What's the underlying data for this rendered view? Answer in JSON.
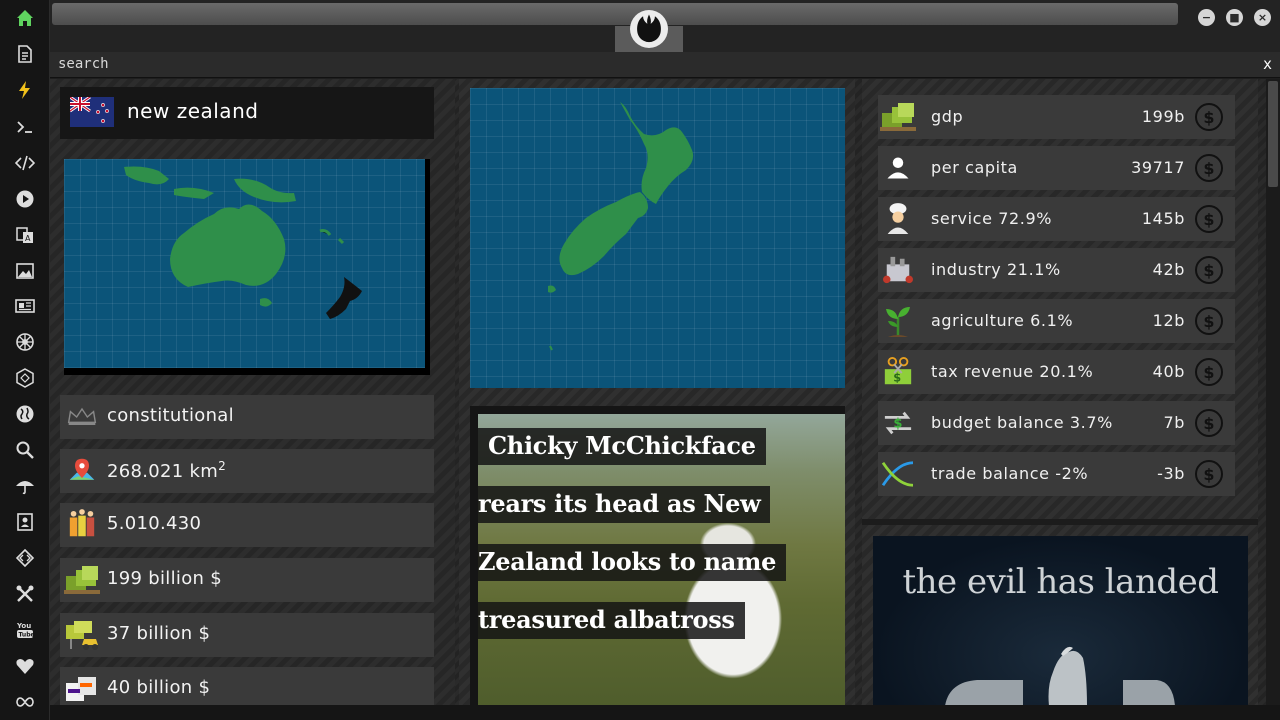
{
  "search": {
    "label": "search",
    "close": "x"
  },
  "window": {
    "minimize": "−",
    "maximize": "■",
    "close": "×"
  },
  "sidebar": {
    "icons": [
      "home-icon",
      "document-icon",
      "lightning-icon",
      "terminal-icon",
      "code-icon",
      "play-icon",
      "translate-icon",
      "image-icon",
      "news-icon",
      "empire-icon",
      "hexagon-icon",
      "globe-icon",
      "search-icon",
      "umbrella-icon",
      "contact-icon",
      "diamond-code-icon",
      "tools-icon",
      "youtube-icon",
      "heart-icon",
      "infinity-icon"
    ],
    "accent": "#5fd35f"
  },
  "country": {
    "name": "new zealand",
    "government": "constitutional",
    "area": "268.021 km",
    "area_exp": "2",
    "population": "5.010.430",
    "gdp": "199 billion $",
    "stat5": "37 billion $",
    "stat6": "40 billion $"
  },
  "economy": [
    {
      "label": "gdp",
      "value": "199b"
    },
    {
      "label": "per capita",
      "value": "39717"
    },
    {
      "label": "service 72.9%",
      "value": "145b"
    },
    {
      "label": "industry 21.1%",
      "value": "42b"
    },
    {
      "label": "agriculture 6.1%",
      "value": "12b"
    },
    {
      "label": "tax revenue 20.1%",
      "value": "40b"
    },
    {
      "label": "budget balance 3.7%",
      "value": "7b"
    },
    {
      "label": "trade balance -2%",
      "value": "-3b"
    }
  ],
  "currency_symbol": "$",
  "news": {
    "lines": [
      "Chicky McChickface",
      "rears its head as New",
      "Zealand looks to name",
      "treasured albatross"
    ]
  },
  "ad": {
    "text": "the evil has landed"
  },
  "colors": {
    "water": "#0b5479",
    "land": "#2f8f4a",
    "highlight": "#111111"
  }
}
